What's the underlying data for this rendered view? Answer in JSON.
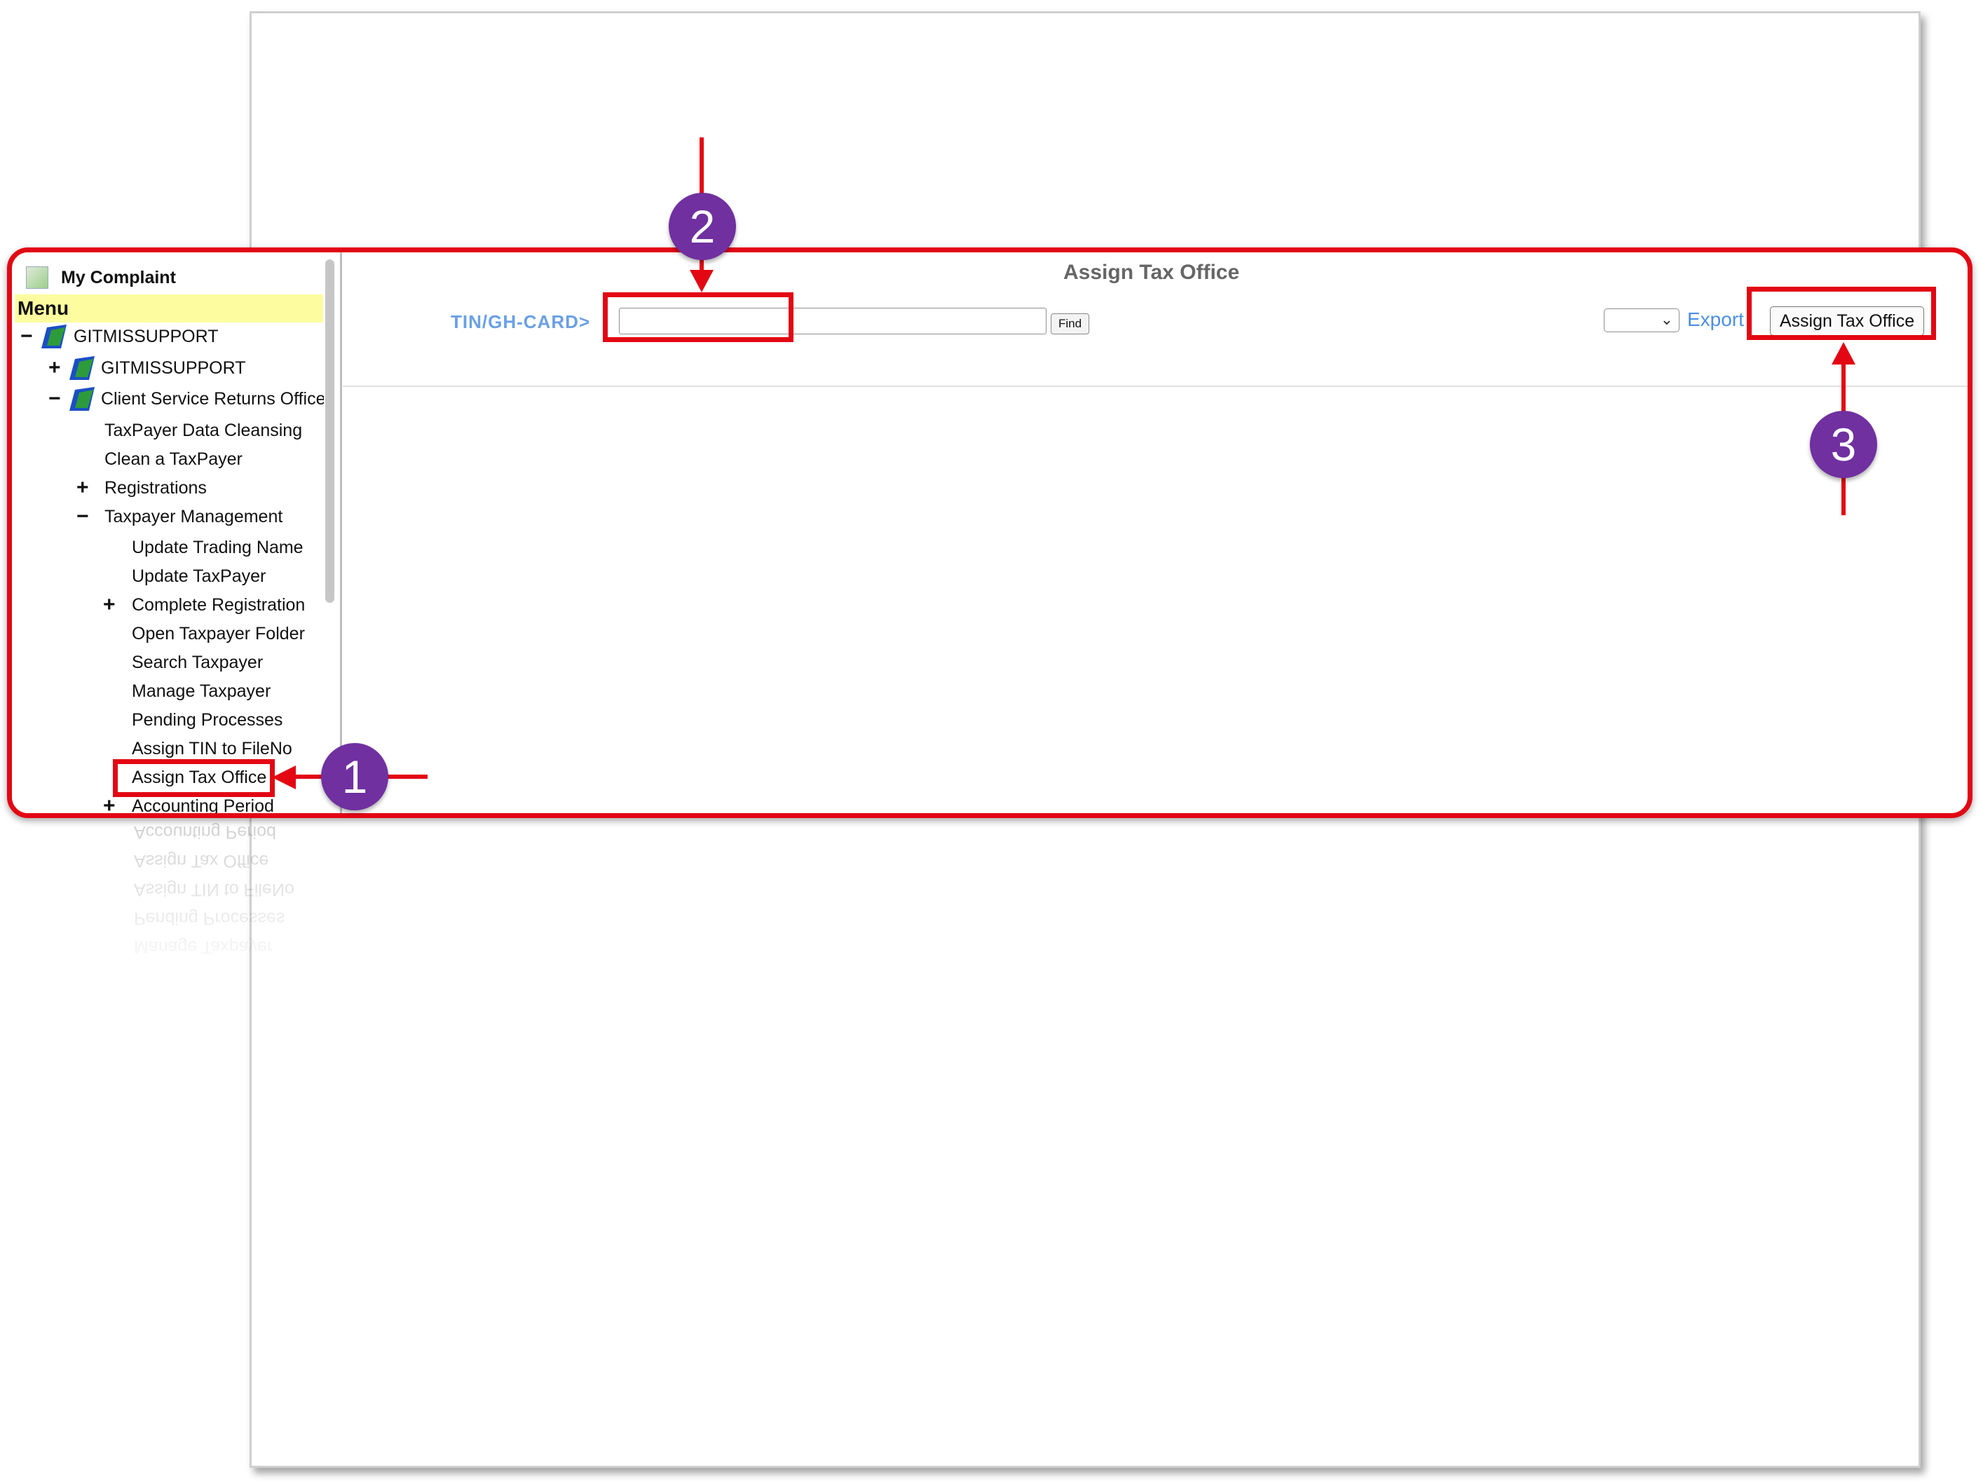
{
  "content": {
    "title": "Assign Tax Office",
    "tin_label": "TIN/GH-CARD>",
    "tin_value": "",
    "find_label": "Find",
    "select_value": "",
    "export_label": "Export",
    "assign_button_label": "Assign Tax Office"
  },
  "sidebar": {
    "complaint_label": "My Complaint",
    "menu_label": "Menu",
    "items": [
      {
        "label": "GITMISSUPPORT",
        "toggle": "−"
      },
      {
        "label": "GITMISSUPPORT",
        "toggle": "+"
      },
      {
        "label": "Client Service Returns Office",
        "toggle": "−"
      },
      {
        "label": "TaxPayer Data Cleansing",
        "toggle": ""
      },
      {
        "label": "Clean a TaxPayer",
        "toggle": ""
      },
      {
        "label": "Registrations",
        "toggle": "+"
      },
      {
        "label": "Taxpayer Management",
        "toggle": "−"
      },
      {
        "label": "Update Trading Name",
        "toggle": ""
      },
      {
        "label": "Update TaxPayer",
        "toggle": ""
      },
      {
        "label": "Complete Registration",
        "toggle": "+"
      },
      {
        "label": "Open Taxpayer Folder",
        "toggle": ""
      },
      {
        "label": "Search Taxpayer",
        "toggle": ""
      },
      {
        "label": "Manage Taxpayer",
        "toggle": ""
      },
      {
        "label": "Pending Processes",
        "toggle": ""
      },
      {
        "label": "Assign TIN to FileNo",
        "toggle": ""
      },
      {
        "label": "Assign Tax Office",
        "toggle": ""
      },
      {
        "label": "Accounting Period",
        "toggle": "+"
      }
    ]
  },
  "annotations": {
    "step1": "1",
    "step2": "2",
    "step3": "3"
  },
  "colors": {
    "highlight": "#e30613",
    "badge": "#7030a0",
    "link": "#4b8fe3",
    "menu_bar": "#fdfda0"
  },
  "icons": [
    "folder-icon",
    "broken-image-icon",
    "chevron-down-icon"
  ]
}
